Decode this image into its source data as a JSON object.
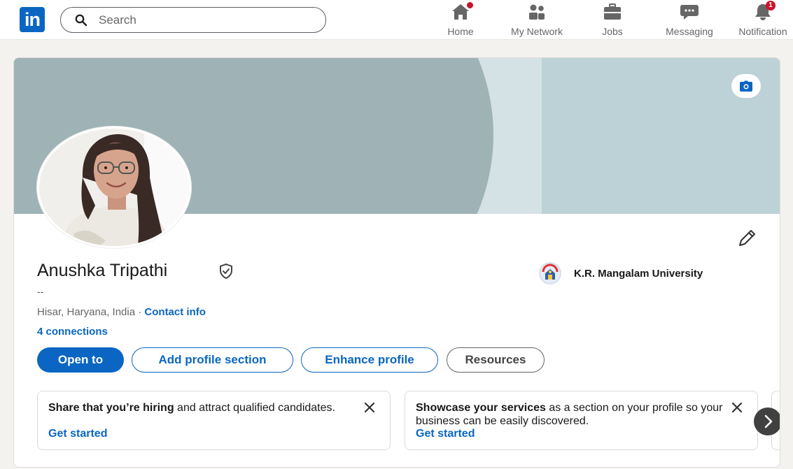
{
  "nav": {
    "logo_text": "in",
    "search_placeholder": "Search",
    "items": [
      {
        "label": "Home",
        "icon": "home-icon",
        "badge": ""
      },
      {
        "label": "My Network",
        "icon": "network-icon",
        "badge": ""
      },
      {
        "label": "Jobs",
        "icon": "briefcase-icon",
        "badge": ""
      },
      {
        "label": "Messaging",
        "icon": "messaging-icon",
        "badge": ""
      },
      {
        "label": "Notification",
        "icon": "bell-icon",
        "badge": "1"
      }
    ]
  },
  "profile": {
    "name": "Anushka Tripathi",
    "headline": "--",
    "location": "Hisar, Haryana, India · ",
    "contact_info": "Contact info",
    "connections": "4 connections",
    "education": "K.R. Mangalam University"
  },
  "actions": {
    "open_to": "Open to",
    "add_section": "Add profile section",
    "enhance": "Enhance profile",
    "resources": "Resources"
  },
  "promos": [
    {
      "bold": "Share that you’re hiring",
      "rest": " and attract qualified candidates.",
      "link": "Get started"
    },
    {
      "bold": "Showcase your services",
      "rest": " as a section on your profile so your business can be easily discovered.",
      "link": "Get started"
    }
  ],
  "colors": {
    "brand": "#0a66c2",
    "badge": "#cb112d"
  }
}
